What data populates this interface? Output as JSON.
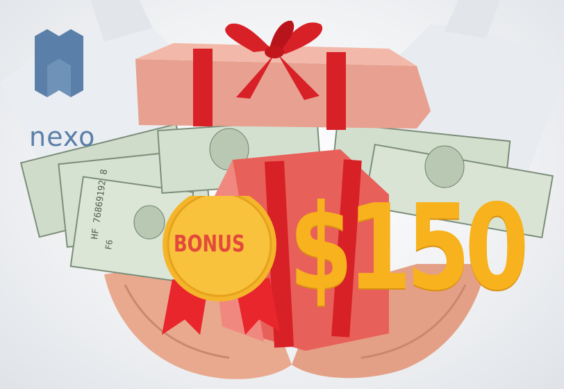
{
  "brand": {
    "name": "nexo",
    "color": "#5a7fa8",
    "logo_icon": "nexo-logo-icon"
  },
  "promo": {
    "badge_label": "BONUS",
    "amount": "$150",
    "badge_color": "#f5b52a",
    "badge_text_color": "#e24a3a",
    "amount_color": "#f7b21e",
    "ribbon_color": "#e8262c",
    "gift_box_color": "#e85c52"
  },
  "banknotes": {
    "serial": "HF 76869192 8",
    "letter": "F6"
  }
}
